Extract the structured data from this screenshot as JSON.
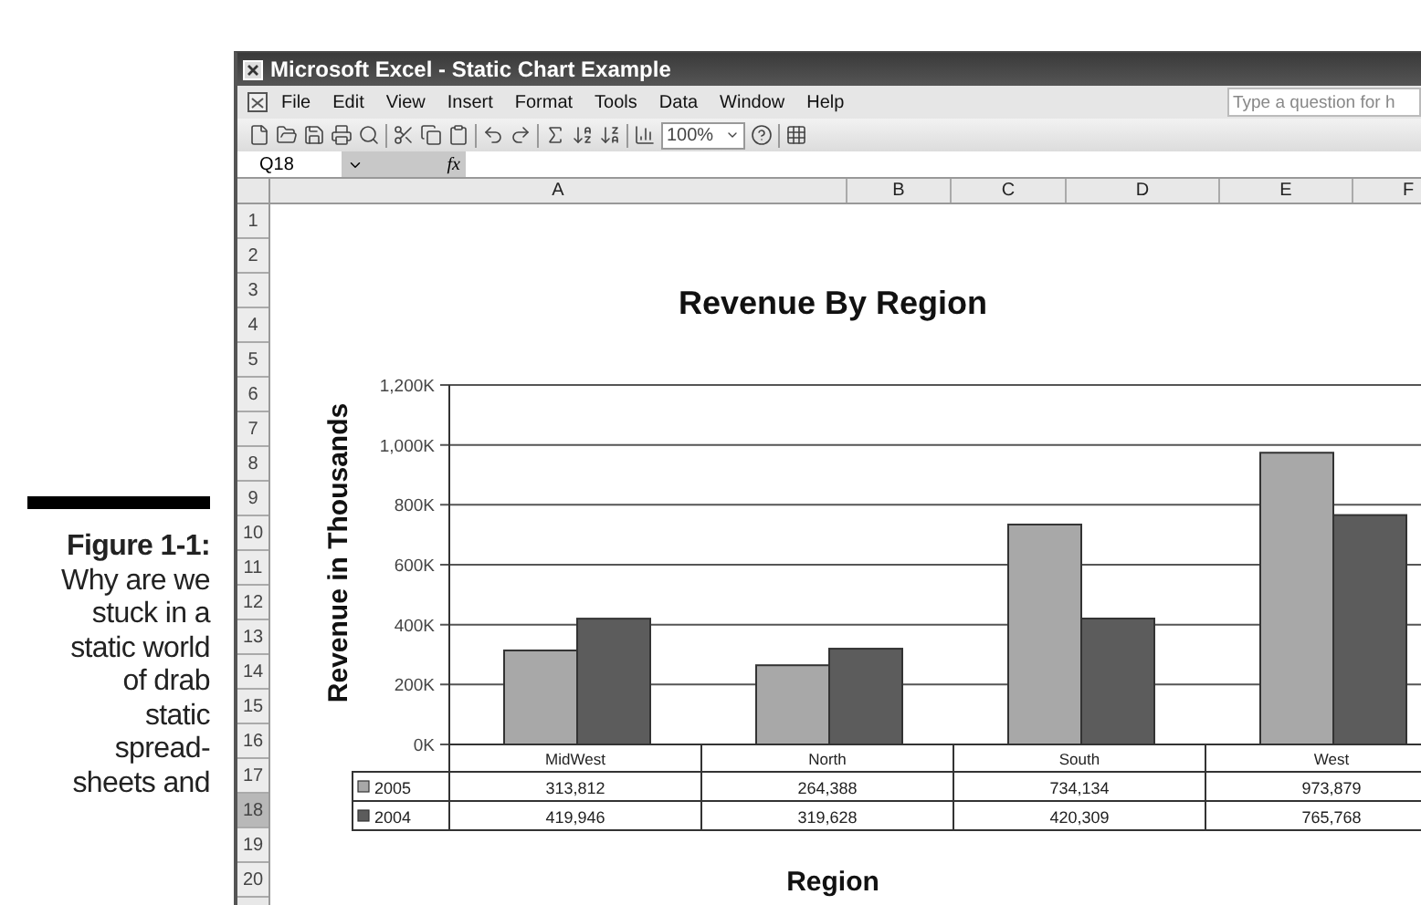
{
  "caption": {
    "label": "Figure 1-1:",
    "lines": [
      "Why are we",
      "stuck in a",
      "static world",
      "of drab",
      "static",
      "spread-",
      "sheets and"
    ]
  },
  "window": {
    "title": "Microsoft Excel - Static Chart Example"
  },
  "menu": [
    "File",
    "Edit",
    "View",
    "Insert",
    "Format",
    "Tools",
    "Data",
    "Window",
    "Help"
  ],
  "question_box": {
    "placeholder": "Type a question for h"
  },
  "toolbar": {
    "zoom": "100%"
  },
  "formula_bar": {
    "name_box": "Q18",
    "fx": "fx"
  },
  "columns": [
    {
      "label": "A",
      "selected": false
    },
    {
      "label": "B",
      "selected": false
    },
    {
      "label": "C",
      "selected": false
    },
    {
      "label": "D",
      "selected": false
    },
    {
      "label": "E",
      "selected": false
    },
    {
      "label": "F",
      "selected": false
    }
  ],
  "rows": [
    {
      "label": "1",
      "selected": false
    },
    {
      "label": "2",
      "selected": false
    },
    {
      "label": "3",
      "selected": false
    },
    {
      "label": "4",
      "selected": false
    },
    {
      "label": "5",
      "selected": false
    },
    {
      "label": "6",
      "selected": false
    },
    {
      "label": "7",
      "selected": false
    },
    {
      "label": "8",
      "selected": false
    },
    {
      "label": "9",
      "selected": false
    },
    {
      "label": "10",
      "selected": false
    },
    {
      "label": "11",
      "selected": false
    },
    {
      "label": "12",
      "selected": false
    },
    {
      "label": "13",
      "selected": false
    },
    {
      "label": "14",
      "selected": false
    },
    {
      "label": "15",
      "selected": false
    },
    {
      "label": "16",
      "selected": false
    },
    {
      "label": "17",
      "selected": false
    },
    {
      "label": "18",
      "selected": true
    },
    {
      "label": "19",
      "selected": false
    },
    {
      "label": "20",
      "selected": false
    }
  ],
  "chart": {
    "chart_data": {
      "type": "bar",
      "title": "Revenue By Region",
      "xlabel": "Region",
      "ylabel": "Revenue in Thousands",
      "categories": [
        "MidWest",
        "North",
        "South",
        "West"
      ],
      "series": [
        {
          "name": "2005",
          "color": "#a8a8a8",
          "values": [
            313812,
            264388,
            734134,
            973879
          ]
        },
        {
          "name": "2004",
          "color": "#5c5c5c",
          "values": [
            419946,
            319628,
            420309,
            765768
          ]
        }
      ],
      "ylim": [
        0,
        1200000
      ],
      "grid": true,
      "legend": true,
      "yticks": [
        {
          "value": 0,
          "label": "0K"
        },
        {
          "value": 200000,
          "label": "200K"
        },
        {
          "value": 400000,
          "label": "400K"
        },
        {
          "value": 600000,
          "label": "600K"
        },
        {
          "value": 800000,
          "label": "800K"
        },
        {
          "value": 1000000,
          "label": "1,000K"
        },
        {
          "value": 1200000,
          "label": "1,200K"
        }
      ]
    },
    "data_table": [
      [
        "313,812",
        "264,388",
        "734,134",
        "973,879"
      ],
      [
        "419,946",
        "319,628",
        "420,309",
        "765,768"
      ]
    ]
  }
}
